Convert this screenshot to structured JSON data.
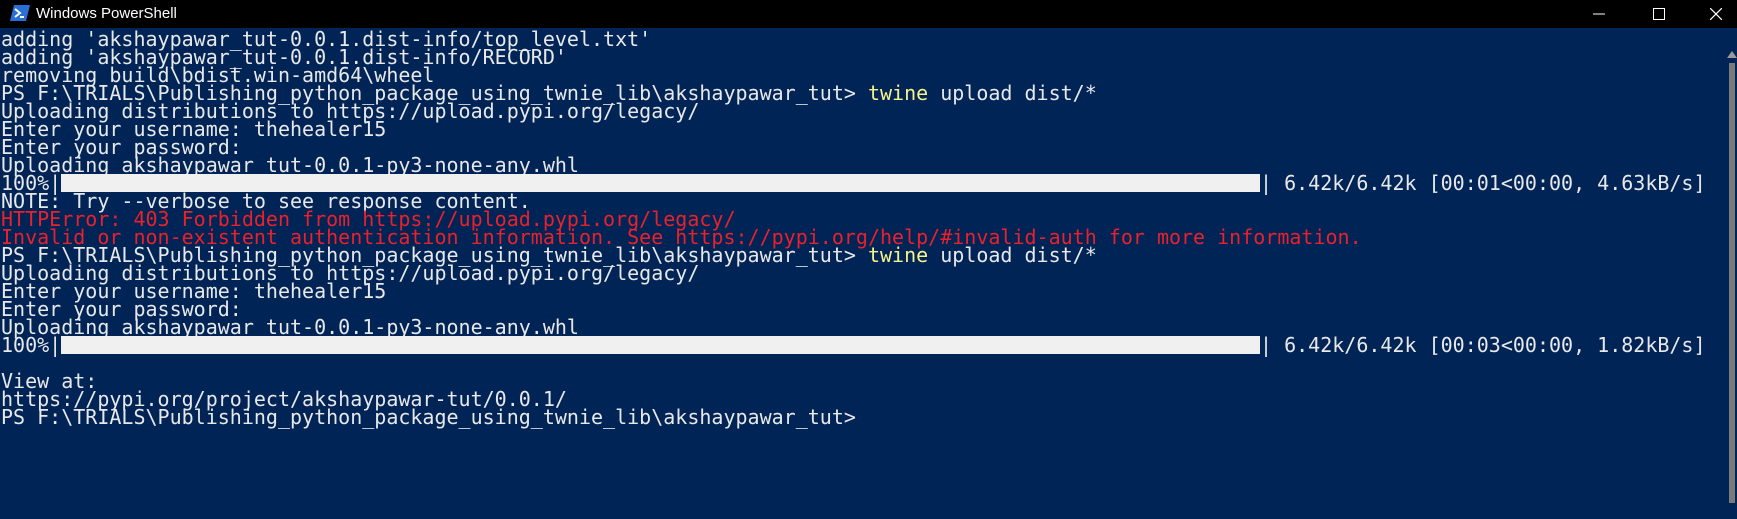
{
  "window": {
    "title": "Windows PowerShell",
    "app_icon": "powershell-icon",
    "controls": [
      "minimize-icon",
      "maximize-icon",
      "close-icon"
    ]
  },
  "colors": {
    "background": "#012456",
    "text": "#e8e8e8",
    "error": "#e8212b",
    "command": "#f5f28c"
  },
  "terminal": {
    "lines": [
      {
        "text": "adding 'akshaypawar_tut-0.0.1.dist-info/top_level.txt'"
      },
      {
        "text": "adding 'akshaypawar_tut-0.0.1.dist-info/RECORD'"
      },
      {
        "text": "removing build\\bdist.win-amd64\\wheel"
      },
      {
        "prompt": "PS F:\\TRIALS\\Publishing_python_package_using_twnie_lib\\akshaypawar_tut> ",
        "command": "twine",
        "args": " upload dist/*"
      },
      {
        "text": "Uploading distributions to https://upload.pypi.org/legacy/"
      },
      {
        "text": "Enter your username: thehealer15"
      },
      {
        "text": "Enter your password:"
      },
      {
        "text": "Uploading akshaypawar_tut-0.0.1-py3-none-any.whl"
      },
      {
        "percent": "100%|",
        "progress": 1.0,
        "stats": "| 6.42k/6.42k [00:01<00:00, 4.63kB/s]"
      },
      {
        "text": "NOTE: Try --verbose to see response content."
      },
      {
        "text": "HTTPError: 403 Forbidden from https://upload.pypi.org/legacy/",
        "error": true
      },
      {
        "text": "Invalid or non-existent authentication information. See https://pypi.org/help/#invalid-auth for more information.",
        "error": true
      },
      {
        "prompt": "PS F:\\TRIALS\\Publishing_python_package_using_twnie_lib\\akshaypawar_tut> ",
        "command": "twine",
        "args": " upload dist/*"
      },
      {
        "text": "Uploading distributions to https://upload.pypi.org/legacy/"
      },
      {
        "text": "Enter your username: thehealer15"
      },
      {
        "text": "Enter your password:"
      },
      {
        "text": "Uploading akshaypawar_tut-0.0.1-py3-none-any.whl"
      },
      {
        "percent": "100%|",
        "progress": 1.0,
        "stats": "| 6.42k/6.42k [00:03<00:00, 1.82kB/s]"
      },
      {
        "text": ""
      },
      {
        "text": "View at:"
      },
      {
        "text": "https://pypi.org/project/akshaypawar-tut/0.0.1/"
      },
      {
        "prompt": "PS F:\\TRIALS\\Publishing_python_package_using_twnie_lib\\akshaypawar_tut>"
      }
    ]
  }
}
